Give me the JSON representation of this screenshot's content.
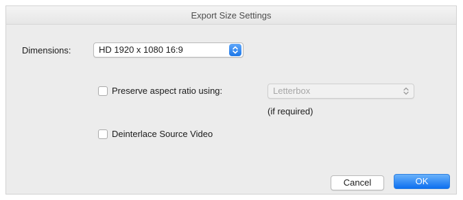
{
  "window": {
    "title": "Export Size Settings"
  },
  "dimensions": {
    "label": "Dimensions:",
    "selected": "HD 1920 x 1080 16:9"
  },
  "preserve_aspect": {
    "label": "Preserve aspect ratio using:",
    "checked": false,
    "selected": "Letterbox",
    "enabled": false,
    "note": "(if required)"
  },
  "deinterlace": {
    "label": "Deinterlace Source Video",
    "checked": false
  },
  "buttons": {
    "cancel": "Cancel",
    "ok": "OK"
  },
  "colors": {
    "accent": "#1c77e8",
    "window_bg": "#ececec"
  },
  "icons": {
    "stepper": "up-down-chevron-icon"
  }
}
